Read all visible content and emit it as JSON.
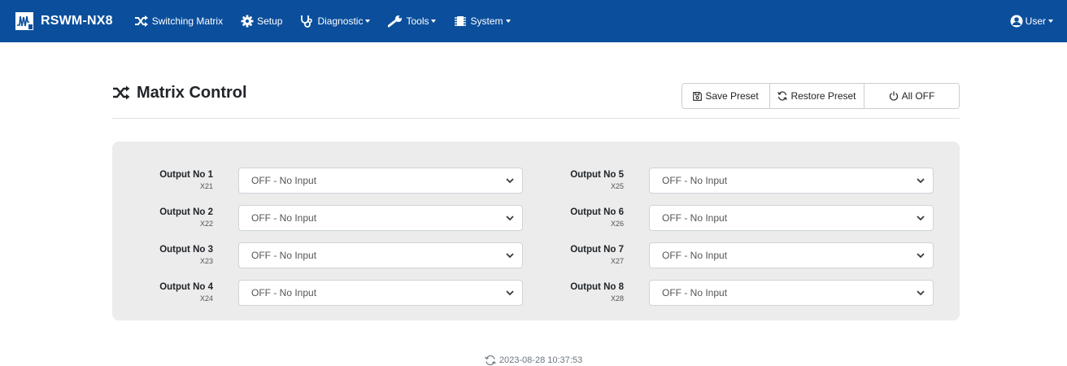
{
  "brand": {
    "name": "RSWM-NX8"
  },
  "nav": {
    "items": [
      {
        "label": "Switching Matrix",
        "icon": "shuffle-icon"
      },
      {
        "label": "Setup",
        "icon": "gear-icon"
      },
      {
        "label": "Diagnostic",
        "icon": "stethoscope-icon"
      },
      {
        "label": "Tools",
        "icon": "wrench-icon"
      },
      {
        "label": "System",
        "icon": "chip-icon"
      }
    ],
    "user_label": "User"
  },
  "page": {
    "title": "Matrix Control",
    "buttons": {
      "save": "Save Preset",
      "restore": "Restore Preset",
      "all_off": "All OFF"
    }
  },
  "outputs": [
    {
      "label": "Output No 1",
      "code": "X21",
      "value": "OFF - No Input"
    },
    {
      "label": "Output No 2",
      "code": "X22",
      "value": "OFF - No Input"
    },
    {
      "label": "Output No 3",
      "code": "X23",
      "value": "OFF - No Input"
    },
    {
      "label": "Output No 4",
      "code": "X24",
      "value": "OFF - No Input"
    },
    {
      "label": "Output No 5",
      "code": "X25",
      "value": "OFF - No Input"
    },
    {
      "label": "Output No 6",
      "code": "X26",
      "value": "OFF - No Input"
    },
    {
      "label": "Output No 7",
      "code": "X27",
      "value": "OFF - No Input"
    },
    {
      "label": "Output No 8",
      "code": "X28",
      "value": "OFF - No Input"
    }
  ],
  "footer": {
    "timestamp": "2023-08-28 10:37:53"
  },
  "colors": {
    "navbar": "#0b4f9c",
    "panel": "#ececec"
  }
}
